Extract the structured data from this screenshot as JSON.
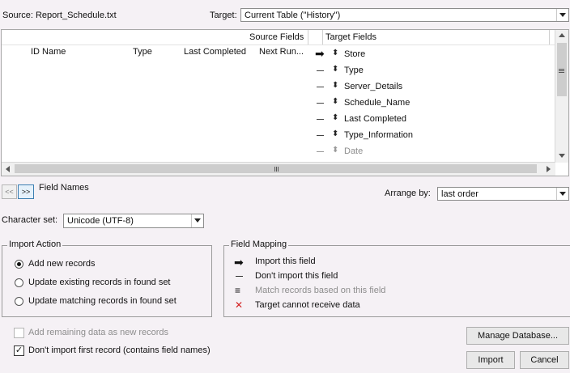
{
  "header": {
    "source_label": "Source: Report_Schedule.txt",
    "target_label": "Target:",
    "target_value": "Current Table (\"History\")"
  },
  "grid": {
    "source_fields_header": "Source Fields",
    "target_fields_header": "Target Fields",
    "source_columns": [
      "ID Name",
      "Type",
      "Last Completed",
      "Next Run..."
    ],
    "rows": [
      {
        "mapping": "import",
        "target": "Store",
        "disabled": false
      },
      {
        "mapping": "dont-import",
        "target": "Type",
        "disabled": false
      },
      {
        "mapping": "dont-import",
        "target": "Server_Details",
        "disabled": false
      },
      {
        "mapping": "dont-import",
        "target": "Schedule_Name",
        "disabled": false
      },
      {
        "mapping": "dont-import",
        "target": "Last Completed",
        "disabled": false
      },
      {
        "mapping": "dont-import",
        "target": "Type_Information",
        "disabled": false
      },
      {
        "mapping": "dont-import",
        "target": "Date",
        "disabled": true
      }
    ]
  },
  "nav": {
    "prev": "<<",
    "next": ">>",
    "label": "Field Names"
  },
  "arrange": {
    "label": "Arrange by:",
    "value": "last order"
  },
  "charset": {
    "label": "Character set:",
    "value": "Unicode (UTF-8)"
  },
  "import_action": {
    "title": "Import Action",
    "options": [
      {
        "label": "Add new records",
        "selected": true
      },
      {
        "label": "Update existing records in found set",
        "selected": false
      },
      {
        "label": "Update matching records in found set",
        "selected": false
      }
    ]
  },
  "field_mapping": {
    "title": "Field Mapping",
    "items": [
      {
        "icon": "arrow-right-icon",
        "label": "Import this field",
        "disabled": false
      },
      {
        "icon": "dash-icon",
        "label": "Don't import this field",
        "disabled": false
      },
      {
        "icon": "equals-icon",
        "label": "Match records based on this field",
        "disabled": true
      },
      {
        "icon": "red-x-icon",
        "label": "Target cannot receive data",
        "disabled": false
      }
    ]
  },
  "options": {
    "add_remaining": "Add remaining data as new records",
    "add_remaining_checked": false,
    "dont_import_first": "Don't import first record (contains field names)",
    "dont_import_first_checked": true
  },
  "buttons": {
    "manage_db": "Manage Database...",
    "import": "Import",
    "cancel": "Cancel"
  }
}
